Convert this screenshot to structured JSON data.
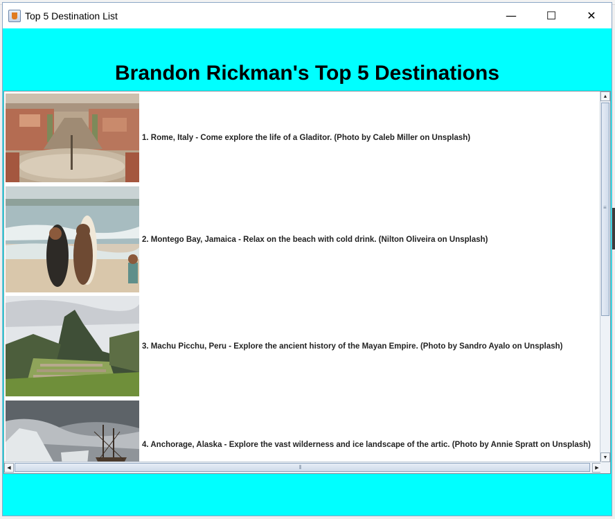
{
  "window": {
    "title": "Top 5 Destination List",
    "minimize_glyph": "—",
    "maximize_glyph": "☐",
    "close_glyph": "✕"
  },
  "heading": "Brandon Rickman's Top 5 Destinations",
  "destinations": [
    {
      "caption": "1. Rome, Italy - Come explore the life of a Gladitor. (Photo by Caleb Miller on Unsplash)",
      "image": "rome-aerial-photo"
    },
    {
      "caption": "2. Montego Bay, Jamaica - Relax on the beach with cold drink. (Nilton Oliveira on Unsplash)",
      "image": "beach-surfboard-photo"
    },
    {
      "caption": "3. Machu Picchu, Peru - Explore the ancient history of the Mayan Empire. (Photo by Sandro Ayalo on Unsplash)",
      "image": "machu-picchu-photo"
    },
    {
      "caption": "4. Anchorage, Alaska - Explore the vast wilderness and ice landscape of the artic. (Photo by Annie Spratt on Unsplash)",
      "image": "alaska-ship-photo"
    }
  ],
  "colors": {
    "frame_background": "#00ffff",
    "list_background": "#ffffff"
  }
}
